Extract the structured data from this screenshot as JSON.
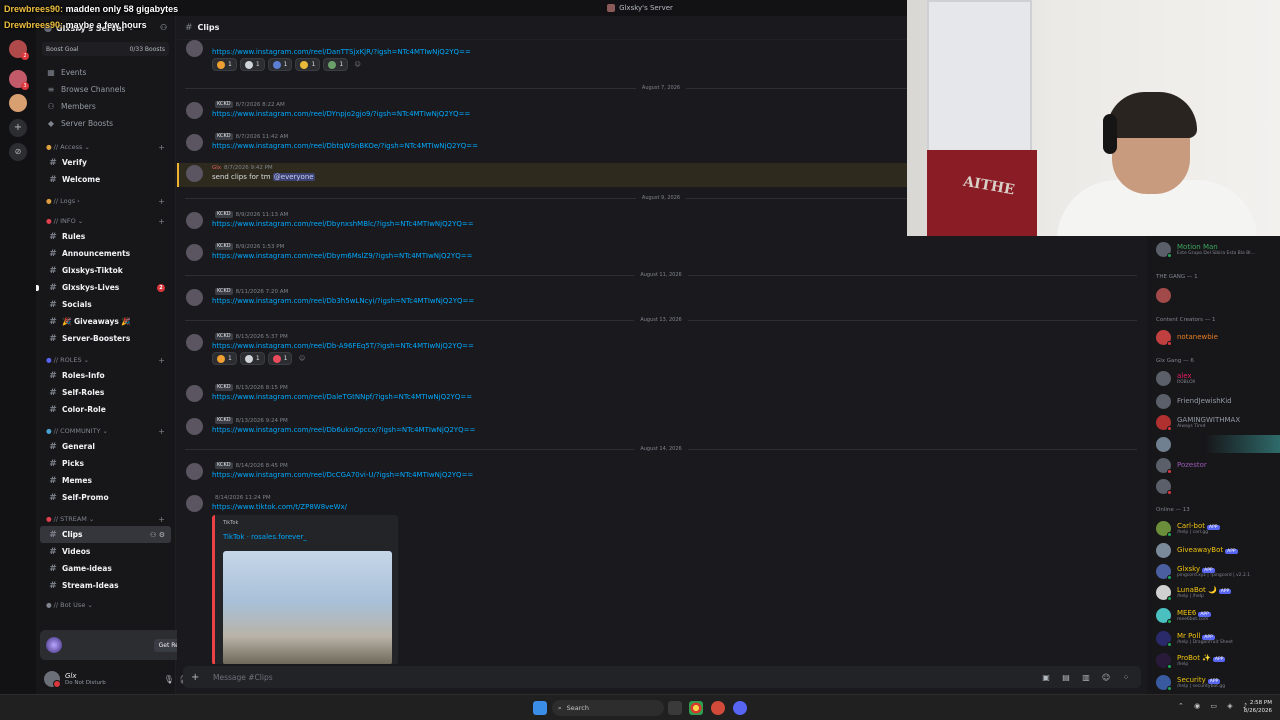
{
  "window": {
    "title": "Glxsky's Server"
  },
  "overlay": [
    {
      "user": "Drewbrees90:",
      "text": "madden only 58 gigabytes"
    },
    {
      "user": "Drewbrees90:",
      "text": "maybe a few hours"
    }
  ],
  "server": {
    "name": "Glxsky's Server",
    "boost_goal": "Boost Goal",
    "boost_count": "0/33 Boosts"
  },
  "nav": [
    {
      "label": "Events",
      "icon": "calendar-icon"
    },
    {
      "label": "Browse Channels",
      "icon": "browse-icon"
    },
    {
      "label": "Members",
      "icon": "members-icon"
    },
    {
      "label": "Server Boosts",
      "icon": "boost-icon"
    }
  ],
  "categories": {
    "access": "// Access",
    "logs": "// Logs",
    "info": "// INFO",
    "roles": "// ROLES",
    "community": "// COMMUNITY",
    "stream": "// STREAM",
    "bot": "// Bot Use"
  },
  "channels": {
    "verify": "Verify",
    "welcome": "Welcome",
    "rules": "Rules",
    "announcements": "Announcements",
    "tiktok": "Glxskys-Tiktok",
    "lives": "Glxskys-Lives",
    "lives_badge": "2",
    "socials": "Socials",
    "giveaways": "🎉 Giveaways 🎉",
    "boosters": "Server-Boosters",
    "roles_info": "Roles-Info",
    "self_roles": "Self-Roles",
    "color_role": "Color-Role",
    "general": "General",
    "picks": "Picks",
    "memes": "Memes",
    "self_promo": "Self-Promo",
    "clips": "Clips",
    "videos": "Videos",
    "game_ideas": "Game-ideas",
    "stream_ideas": "Stream-Ideas"
  },
  "promo": {
    "label": "Get Reward!"
  },
  "user": {
    "name": "Glx",
    "status": "Do Not Disturb"
  },
  "chat": {
    "channel": "Clips",
    "placeholder": "Message #Clips"
  },
  "messages": {
    "m0": {
      "time": "",
      "body": "https://www.instagram.com/reel/DanTTSjxKjR/?igsh=NTc4MTIwNjQ2YQ=="
    },
    "d1": "August 7, 2026",
    "m1": {
      "tag": "KCKD",
      "time": "8/7/2026 8:22 AM",
      "body": "https://www.instagram.com/reel/DYnpjo2gjo9/?igsh=NTc4MTIwNjQ2YQ=="
    },
    "m2": {
      "tag": "KCKD",
      "time": "8/7/2026 11:42 AM",
      "body": "https://www.instagram.com/reel/DbtqWSnBKOe/?igsh=NTc4MTIwNjQ2YQ=="
    },
    "m3": {
      "author": "Glx",
      "time": "8/7/2026 9:42 PM",
      "text": "send clips for tm ",
      "mention": "@everyone"
    },
    "d2": "August 9, 2026",
    "m4": {
      "tag": "KCKD",
      "time": "8/9/2026 11:13 AM",
      "body": "https://www.instagram.com/reel/DbynxshMBlc/?igsh=NTc4MTIwNjQ2YQ=="
    },
    "m5": {
      "tag": "KCKD",
      "time": "8/9/2026 1:53 PM",
      "body": "https://www.instagram.com/reel/Dbym6MslZ9/?igsh=NTc4MTIwNjQ2YQ=="
    },
    "d3": "August 11, 2026",
    "m6": {
      "tag": "KCKD",
      "time": "8/11/2026 7:20 AM",
      "body": "https://www.instagram.com/reel/Db3h5wLNcyi/?igsh=NTc4MTIwNjQ2YQ=="
    },
    "d4": "August 13, 2026",
    "m7": {
      "tag": "KCKD",
      "time": "8/13/2026 5:37 PM",
      "body": "https://www.instagram.com/reel/Db-A96FEq5T/?igsh=NTc4MTIwNjQ2YQ=="
    },
    "m8": {
      "tag": "KCKD",
      "time": "8/13/2026 8:15 PM",
      "body": "https://www.instagram.com/reel/DaleTGtNNpf/?igsh=NTc4MTIwNjQ2YQ=="
    },
    "m9": {
      "tag": "KCKD",
      "time": "8/13/2026 9:24 PM",
      "body": "https://www.instagram.com/reel/Db6uknOpccx/?igsh=NTc4MTIwNjQ2YQ=="
    },
    "d5": "August 14, 2026",
    "m10": {
      "tag": "KCKD",
      "time": "8/14/2026 8:45 PM",
      "body": "https://www.instagram.com/reel/DcCGA70vi-U/?igsh=NTc4MTIwNjQ2YQ=="
    },
    "m11": {
      "time": "8/14/2026 11:24 PM",
      "body": "https://www.tiktok.com/t/ZP8W8veWx/"
    }
  },
  "reactions": {
    "row1": [
      {
        "count": "1",
        "color": "#f0a030"
      },
      {
        "count": "1",
        "color": "#cfd3da"
      },
      {
        "count": "1",
        "color": "#5b7fd4"
      },
      {
        "count": "1",
        "color": "#e8b838"
      },
      {
        "count": "1",
        "color": "#6aa06a"
      }
    ],
    "row2": [
      {
        "count": "1",
        "color": "#f0a030"
      },
      {
        "count": "1",
        "color": "#cfd3da"
      },
      {
        "count": "1",
        "color": "#e84c5c"
      }
    ]
  },
  "embed": {
    "provider": "TikTok",
    "title": "TikTok · rosales.forever_"
  },
  "members": {
    "top": {
      "name": "Motion Man",
      "status": "Este Grupo Del Sibira Esta Bla Bl..."
    },
    "the_gang": "THE GANG — 1",
    "creators": "Content Creators — 1",
    "creator1": "notanewbie",
    "glx_gang": "Glx Gang — 6",
    "g1": {
      "name": "alex",
      "status": "ROBLOX"
    },
    "g2": {
      "name": "FriendJewishKid"
    },
    "g3": {
      "name": "GAMINGWITHMAX",
      "status": "Always Tired"
    },
    "g5": {
      "name": "Pozestor"
    },
    "online": "Online — 13",
    "b1": {
      "name": "Carl-bot",
      "status": "/help | carl.gg"
    },
    "b2": {
      "name": "GiveawayBot"
    },
    "b3": {
      "name": "Glxsky",
      "status": "pingcord.xyz | !pingcord | v2.2.1"
    },
    "b4": {
      "name": "LunaBot 🌙",
      "status": "/help | /help"
    },
    "b5": {
      "name": "MEE6",
      "status": "mee6bot.com"
    },
    "b6": {
      "name": "Mr Poll",
      "status": "/help | Dragonfruit Sheet"
    },
    "b7": {
      "name": "ProBot ✨",
      "status": "/help"
    },
    "b8": {
      "name": "Security",
      "status": "/help | securitybot.gg"
    },
    "app": "APP"
  },
  "taskbar": {
    "search": "Search",
    "time": "2:58 PM",
    "date": "8/26/2026"
  },
  "colors": {
    "link": "#00a8fc",
    "mention_bg": "#3c4270",
    "dnd": "#da373c",
    "online": "#23a55a",
    "idle": "#f0b232",
    "brand": "#5865f2"
  }
}
